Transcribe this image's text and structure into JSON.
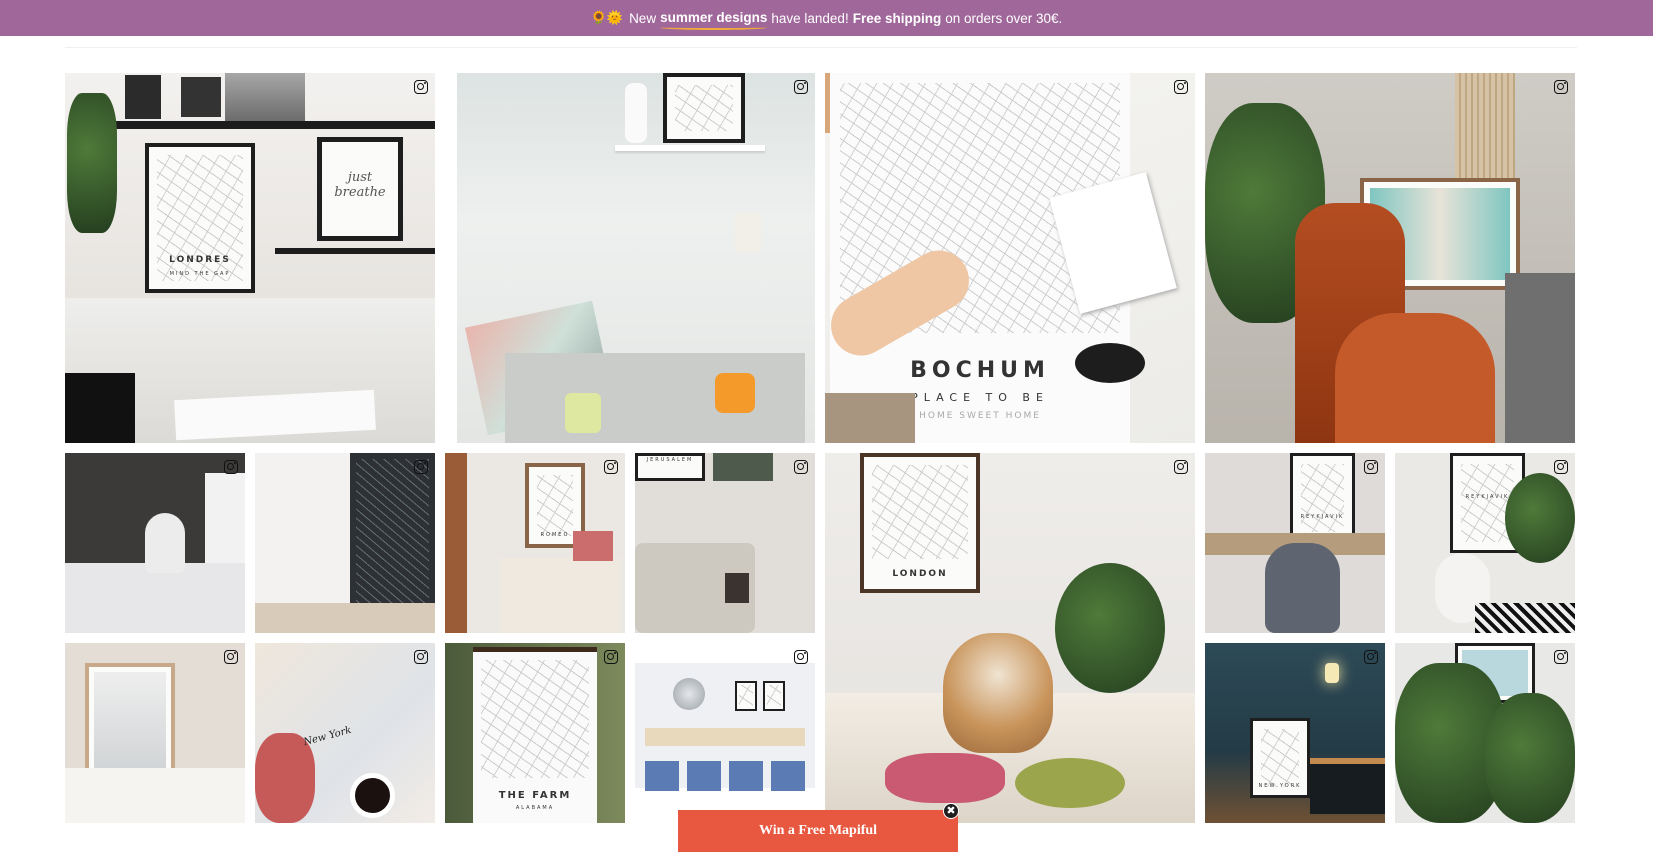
{
  "announcement": {
    "emoji": "🌻🌞",
    "t1": "New",
    "t2": "summer designs",
    "t3": "have landed!",
    "t4": "Free shipping",
    "t5": "on orders over 30€."
  },
  "tiles": {
    "t1_caption": "LONDRES",
    "t1_sub": "MIND THE GAP",
    "t1_art": "just breathe",
    "t3_caption": "BOCHUM",
    "t3_sub": "PLACE TO BE",
    "t3_sub2": "HOME SWEET HOME",
    "t9_caption": "LONDON",
    "t10_caption": "REYKJAVIK",
    "t11_caption": "REYKJAVIK",
    "t14_caption": "THE FARM",
    "t14_sub": "ALABAMA",
    "t8_caption": "JERUSALEM",
    "t7_caption": "ROMEO",
    "t13_caption": "New York",
    "t16_caption": "NEW YORK"
  },
  "popup": {
    "label": "Win a Free Mapiful",
    "close_icon": "close-icon"
  },
  "colors": {
    "announcement_bg": "#a0679a",
    "banner_bg": "#e8573f"
  }
}
